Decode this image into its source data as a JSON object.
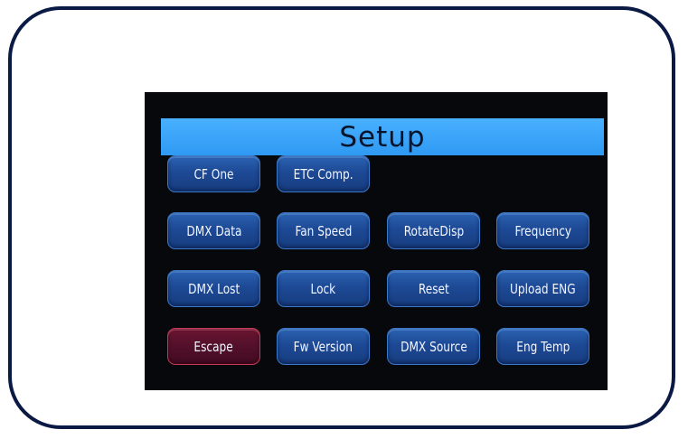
{
  "screen": {
    "title": "Setup"
  },
  "buttons": {
    "cf_one": "CF One",
    "etc_comp": "ETC Comp.",
    "dmx_data": "DMX Data",
    "fan_speed": "Fan Speed",
    "rotate_disp": "RotateDisp",
    "frequency": "Frequency",
    "dmx_lost": "DMX Lost",
    "lock": "Lock",
    "reset": "Reset",
    "upload_eng": "Upload ENG",
    "escape": "Escape",
    "fw_version": "Fw Version",
    "dmx_source": "DMX Source",
    "eng_temp": "Eng Temp"
  },
  "colors": {
    "title_bar": "#3aa3f8",
    "button_blue": "#1d4995",
    "button_escape": "#53102a",
    "screen_bg": "#07080b",
    "frame_border": "#0b1a44"
  }
}
